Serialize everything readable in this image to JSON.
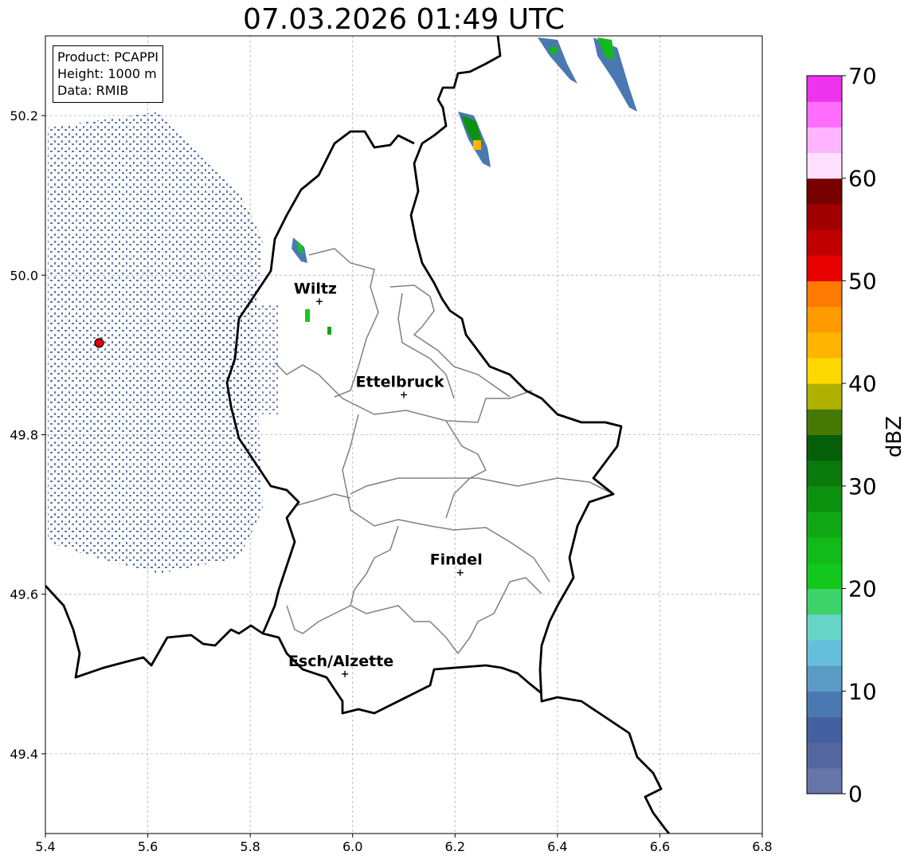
{
  "title": "07.03.2026 01:49 UTC",
  "info": {
    "product": "Product: PCAPPI",
    "height": "Height: 1000 m",
    "data": "Data: RMIB"
  },
  "axes": {
    "x_ticks": [
      "5.4",
      "5.6",
      "5.8",
      "6.0",
      "6.2",
      "6.4",
      "6.6",
      "6.8"
    ],
    "y_ticks": [
      "49.4",
      "49.6",
      "49.8",
      "50.0",
      "50.2"
    ],
    "xlim": [
      5.4,
      6.8
    ],
    "ylim": [
      49.3,
      50.3
    ],
    "grid": true
  },
  "colorbar": {
    "label": "dBZ",
    "min": 0,
    "max": 70,
    "ticks": [
      "0",
      "10",
      "20",
      "30",
      "40",
      "50",
      "60",
      "70"
    ],
    "colors": [
      "#6676a8",
      "#5567a0",
      "#4560a0",
      "#4a78b0",
      "#5a9cc6",
      "#66bfdc",
      "#66d4c6",
      "#3dd26a",
      "#13c81d",
      "#12ba1a",
      "#10a814",
      "#0d9210",
      "#0a7a0c",
      "#075e08",
      "#467a04",
      "#b0b000",
      "#ffd800",
      "#ffb400",
      "#ff9a00",
      "#ff7a00",
      "#e80000",
      "#c00000",
      "#a00000",
      "#780000",
      "#ffe0ff",
      "#ffb4ff",
      "#ff6eff",
      "#ee33ee"
    ]
  },
  "places": [
    {
      "name": "Wiltz",
      "lon": 5.935,
      "lat": 49.967
    },
    {
      "name": "Ettelbruck",
      "lon": 6.1,
      "lat": 49.85
    },
    {
      "name": "Findel",
      "lon": 6.21,
      "lat": 49.627
    },
    {
      "name": "Esch/Alzette",
      "lon": 5.985,
      "lat": 49.5
    }
  ],
  "radar_site": {
    "name": "radar-site",
    "lon": 5.505,
    "lat": 49.915
  }
}
